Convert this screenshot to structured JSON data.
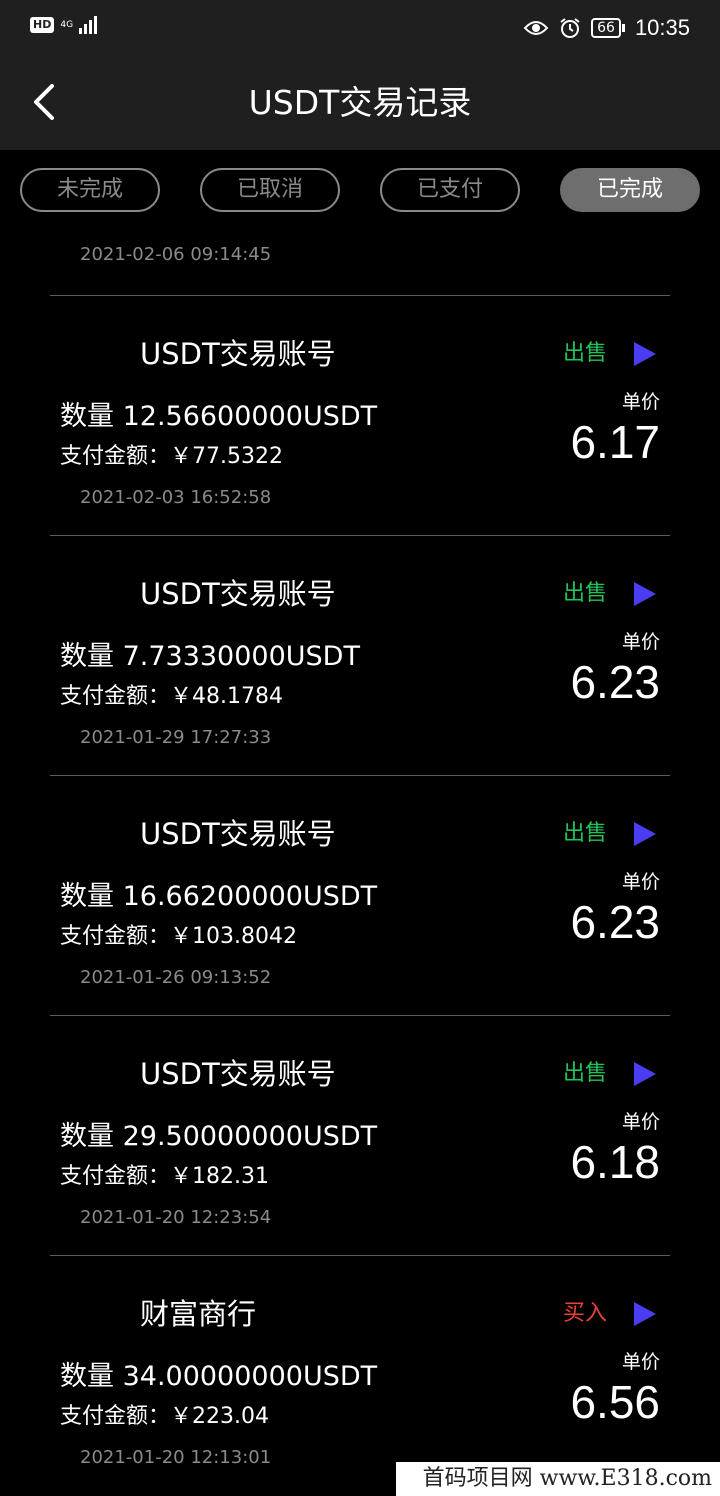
{
  "status_bar": {
    "hd": "HD",
    "network": "4G",
    "battery": "66",
    "time": "10:35",
    "icons": [
      "eye-icon",
      "alarm-icon",
      "battery-icon"
    ]
  },
  "header": {
    "title": "USDT交易记录",
    "back_icon": "chevron-left-icon"
  },
  "tabs": [
    {
      "label": "未完成",
      "active": false
    },
    {
      "label": "已取消",
      "active": false
    },
    {
      "label": "已支付",
      "active": false
    },
    {
      "label": "已完成",
      "active": true
    }
  ],
  "partial_record_time": "2021-02-06 09:14:45",
  "records": [
    {
      "name": "USDT交易账号",
      "type": "出售",
      "type_color": "#22c25a",
      "quantity": "数量 12.56600000USDT",
      "pay": "支付金额：￥77.5322",
      "price_label": "单价",
      "price": "6.17",
      "time": "2021-02-03 16:52:58"
    },
    {
      "name": "USDT交易账号",
      "type": "出售",
      "type_color": "#22c25a",
      "quantity": "数量 7.73330000USDT",
      "pay": "支付金额：￥48.1784",
      "price_label": "单价",
      "price": "6.23",
      "time": "2021-01-29 17:27:33"
    },
    {
      "name": "USDT交易账号",
      "type": "出售",
      "type_color": "#22c25a",
      "quantity": "数量 16.66200000USDT",
      "pay": "支付金额：￥103.8042",
      "price_label": "单价",
      "price": "6.23",
      "time": "2021-01-26 09:13:52"
    },
    {
      "name": "USDT交易账号",
      "type": "出售",
      "type_color": "#22c25a",
      "quantity": "数量 29.50000000USDT",
      "pay": "支付金额：￥182.31",
      "price_label": "单价",
      "price": "6.18",
      "time": "2021-01-20 12:23:54"
    },
    {
      "name": "财富商行",
      "type": "买入",
      "type_color": "#e8413a",
      "quantity": "数量 34.00000000USDT",
      "pay": "支付金额：￥223.04",
      "price_label": "单价",
      "price": "6.56",
      "time": "2021-01-20 12:13:01"
    }
  ],
  "watermark": "首码项目网 www.E318.com",
  "colors": {
    "accent_play": "#4a3cf0",
    "sell": "#22c25a",
    "buy": "#e8413a"
  }
}
